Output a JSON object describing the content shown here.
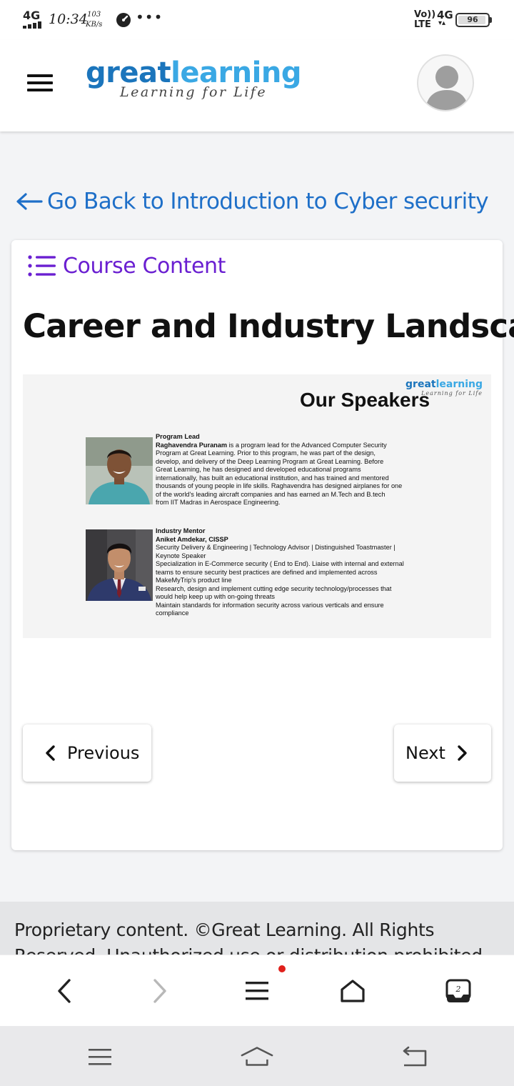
{
  "status_bar": {
    "network": "4G",
    "time": "10:34",
    "speed_value": "103",
    "speed_unit": "KB/s",
    "more": "•••",
    "volte": "Vo))",
    "lte": "LTE",
    "network_right": "4G",
    "battery": "96",
    "battery_level": 0.96
  },
  "header": {
    "logo_great": "great",
    "logo_learning": "learning",
    "logo_tagline": "Learning for Life",
    "colors": {
      "great": "#1b75bc",
      "learning": "#3aa8e4"
    }
  },
  "back_link": {
    "label": "Go Back to Introduction to Cyber security"
  },
  "course_content": {
    "label": "Course Content",
    "icon": "list-icon",
    "accent": "#6a1fd1"
  },
  "lesson": {
    "title": "Career and Industry Landscape"
  },
  "slide": {
    "logo_great": "great",
    "logo_learning": "learning",
    "logo_tagline": "Learning for Life",
    "title": "Our Speakers",
    "speakers": [
      {
        "role": "Program Lead",
        "name": "Raghavendra Puranam",
        "lines": [
          " is a program lead for the Advanced Computer Security",
          "Program at Great Learning. Prior to this program, he was part of the design,",
          "develop, and delivery of the Deep Learning Program at Great Learning.  Before",
          "Great Learning, he has designed and developed educational programs",
          "internationally, has built an educational institution, and has trained and mentored",
          "thousands of young people in life skills. Raghavendra has designed airplanes for one",
          "of the world's leading aircraft companies and has earned an M.Tech and B.tech",
          "from IIT Madras in Aerospace Engineering."
        ]
      },
      {
        "role": "Industry Mentor",
        "name": "Aniket Amdekar, CISSP",
        "lines": [
          "Security Delivery & Engineering | Technology Advisor | Distinguished Toastmaster |",
          "Keynote Speaker",
          "Specialization in E-Commerce security ( End to End). Liaise with internal and external",
          "teams to ensure security best practices are defined and implemented across",
          "MakeMyTrip's product line",
          "Research, design and implement cutting edge security technology/processes that",
          "would help keep up with on-going threats",
          "Maintain standards for information security across various verticals and ensure",
          "compliance"
        ]
      }
    ]
  },
  "navigation": {
    "previous_label": "Previous",
    "next_label": "Next"
  },
  "footer": {
    "text": "Proprietary content. ©Great Learning. All Rights Reserved. Unauthorized use or distribution prohibited."
  },
  "browser_bar": {
    "tabs_count": "2",
    "icons": [
      "back-icon",
      "forward-icon",
      "menu-icon",
      "home-icon",
      "tabs-icon"
    ]
  },
  "system_nav": {
    "icons": [
      "recents-icon",
      "home-icon",
      "back-icon"
    ]
  }
}
